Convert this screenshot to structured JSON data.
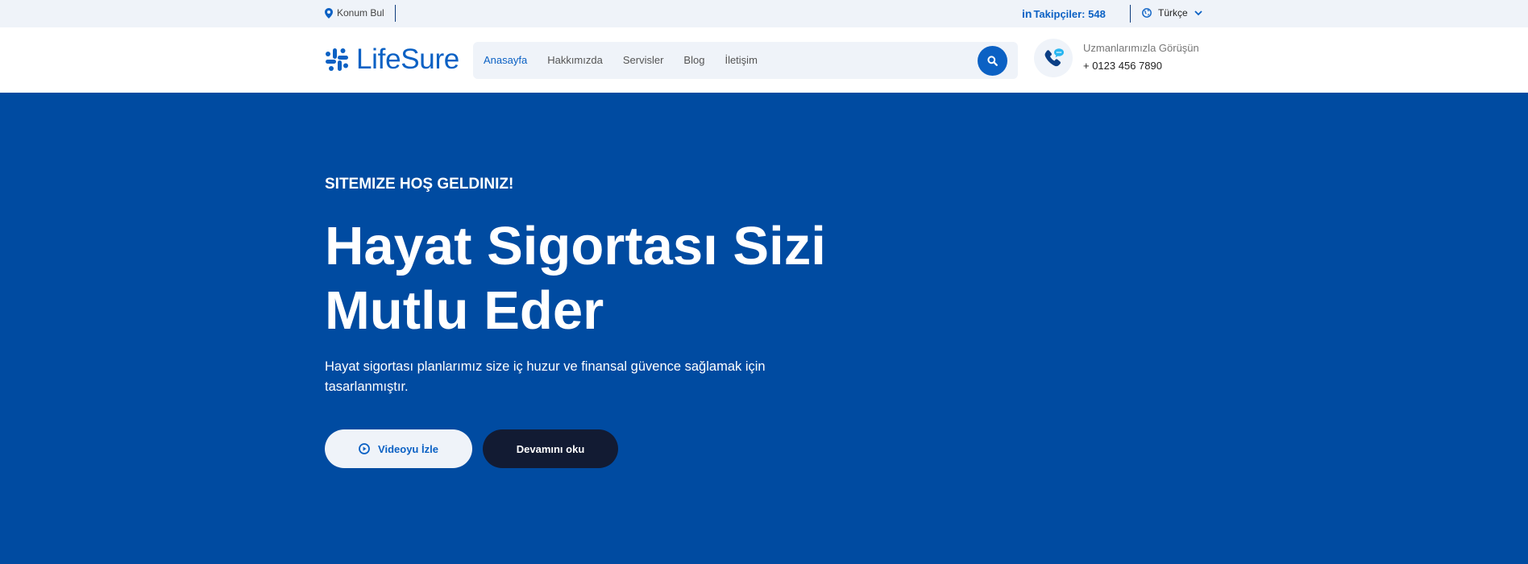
{
  "topbar": {
    "location_label": "Konum Bul",
    "followers_prefix": "in",
    "followers_label": "Takipçiler: 548",
    "language_label": "Türkçe"
  },
  "header": {
    "logo_text": "LifeSure",
    "nav": [
      {
        "label": "Anasayfa",
        "active": true
      },
      {
        "label": "Hakkımızda",
        "active": false
      },
      {
        "label": "Servisler",
        "active": false
      },
      {
        "label": "Blog",
        "active": false
      },
      {
        "label": "İletişim",
        "active": false
      }
    ],
    "contact_title": "Uzmanlarımızla Görüşün",
    "contact_phone": "+ 0123 456 7890"
  },
  "hero": {
    "eyebrow": "SITEMIZE HOŞ GELDINIZ!",
    "headline": "Hayat Sigortası Sizi Mutlu Eder",
    "description": "Hayat sigortası planlarımız size iç huzur ve finansal güvence sağlamak için tasarlanmıştır.",
    "video_button": "Videoyu İzle",
    "more_button": "Devamını oku"
  },
  "icons": [
    "map-pin-icon",
    "linkedin-icon",
    "globe-icon",
    "chevron-down-icon",
    "logo-icon",
    "search-icon",
    "phone-chat-icon",
    "play-icon"
  ],
  "colors": {
    "brand_blue": "#0b61c4",
    "hero_background": "#004ba1",
    "topbar_background": "#eff3f9",
    "dark_button": "#121b33"
  }
}
